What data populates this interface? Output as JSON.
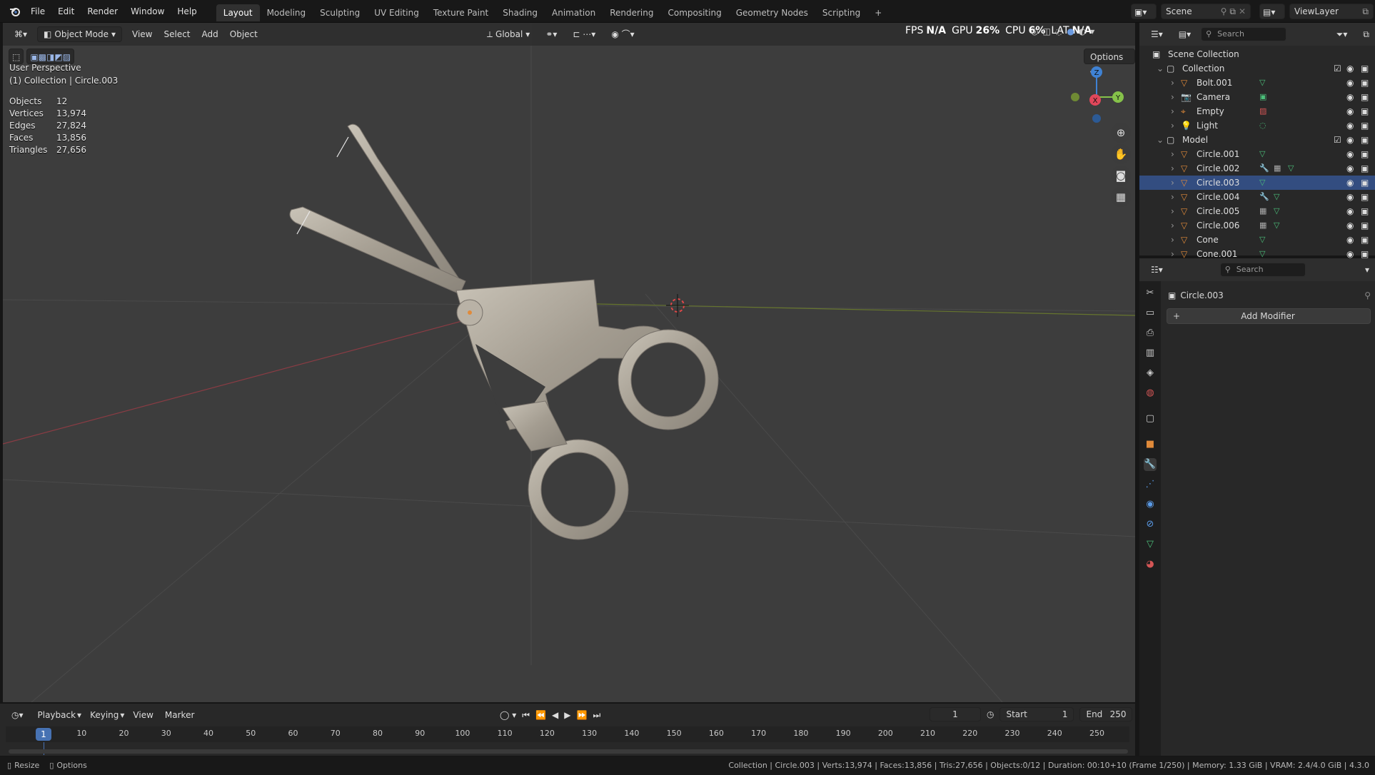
{
  "app": {
    "logo_icon": "blender-logo-icon"
  },
  "menu": [
    "File",
    "Edit",
    "Render",
    "Window",
    "Help"
  ],
  "workspaces": [
    "Layout",
    "Modeling",
    "Sculpting",
    "UV Editing",
    "Texture Paint",
    "Shading",
    "Animation",
    "Rendering",
    "Compositing",
    "Geometry Nodes",
    "Scripting",
    "+"
  ],
  "active_workspace": "Layout",
  "scene": {
    "name": "Scene",
    "view_layer": "ViewLayer"
  },
  "viewport_header": {
    "mode": "Object Mode",
    "menus": [
      "View",
      "Select",
      "Add",
      "Object"
    ],
    "orientation": "Global",
    "options": "Options"
  },
  "perf": {
    "fps_label": "FPS",
    "fps": "N/A",
    "gpu_label": "GPU",
    "gpu": "26%",
    "cpu_label": "CPU",
    "cpu": "6%",
    "lat_label": "LAT",
    "lat": "N/A"
  },
  "viewport_overlay": {
    "view_name": "User Perspective",
    "context": "(1) Collection | Circle.003",
    "stats": [
      {
        "k": "Objects",
        "v": "12"
      },
      {
        "k": "Vertices",
        "v": "13,974"
      },
      {
        "k": "Edges",
        "v": "27,824"
      },
      {
        "k": "Faces",
        "v": "13,856"
      },
      {
        "k": "Triangles",
        "v": "27,656"
      }
    ]
  },
  "gizmo": {
    "x": "X",
    "y": "Y",
    "z": "Z"
  },
  "outliner": {
    "search_placeholder": "Search",
    "root": "Scene Collection",
    "collections": [
      {
        "name": "Collection",
        "items": [
          {
            "name": "Bolt.001",
            "type": "mesh",
            "extras": [
              "mesh-data-icon"
            ]
          },
          {
            "name": "Camera",
            "type": "camera",
            "extras": [
              "camera-data-icon"
            ]
          },
          {
            "name": "Empty",
            "type": "empty",
            "extras": [
              "image-icon"
            ]
          },
          {
            "name": "Light",
            "type": "light",
            "extras": [
              "light-data-icon"
            ]
          }
        ]
      },
      {
        "name": "Model",
        "items": [
          {
            "name": "Circle.001",
            "type": "mesh",
            "extras": [
              "mesh-data-icon"
            ]
          },
          {
            "name": "Circle.002",
            "type": "mesh",
            "extras": [
              "wrench-icon",
              "modifier-grid-icon",
              "mesh-data-icon"
            ]
          },
          {
            "name": "Circle.003",
            "type": "mesh",
            "extras": [
              "mesh-data-icon"
            ],
            "selected": true
          },
          {
            "name": "Circle.004",
            "type": "mesh",
            "extras": [
              "wrench-icon",
              "mesh-data-icon"
            ]
          },
          {
            "name": "Circle.005",
            "type": "mesh",
            "extras": [
              "modifier-grid-icon",
              "mesh-data-icon"
            ]
          },
          {
            "name": "Circle.006",
            "type": "mesh",
            "extras": [
              "modifier-grid-icon",
              "mesh-data-icon"
            ]
          },
          {
            "name": "Cone",
            "type": "mesh",
            "extras": [
              "mesh-data-icon"
            ]
          },
          {
            "name": "Cone.001",
            "type": "mesh",
            "extras": [
              "mesh-data-icon"
            ]
          }
        ]
      }
    ]
  },
  "properties": {
    "search_placeholder": "Search",
    "object_name": "Circle.003",
    "add_modifier": "Add Modifier"
  },
  "timeline": {
    "menus": [
      "Playback",
      "Keying",
      "View",
      "Marker"
    ],
    "current_frame": "1",
    "start_label": "Start",
    "start": "1",
    "end_label": "End",
    "end": "250",
    "ticks": [
      "10",
      "20",
      "30",
      "40",
      "50",
      "60",
      "70",
      "80",
      "90",
      "100",
      "110",
      "120",
      "130",
      "140",
      "150",
      "160",
      "170",
      "180",
      "190",
      "200",
      "210",
      "220",
      "230",
      "240",
      "250"
    ],
    "playhead": "1"
  },
  "statusbar": {
    "left": [
      "Resize",
      "Options"
    ],
    "right": "Collection | Circle.003 | Verts:13,974 | Faces:13,856 | Tris:27,656 | Objects:0/12 | Duration: 00:10+10 (Frame 1/250) | Memory: 1.33 GiB | VRAM: 2.4/4.0 GiB | 4.3.0"
  },
  "colors": {
    "accent": "#4772b3",
    "selected_row": "#334d80",
    "axis_x": "#e0475a",
    "axis_y": "#86c24a",
    "axis_z": "#3f82d4",
    "object_orange": "#e08a3a"
  }
}
